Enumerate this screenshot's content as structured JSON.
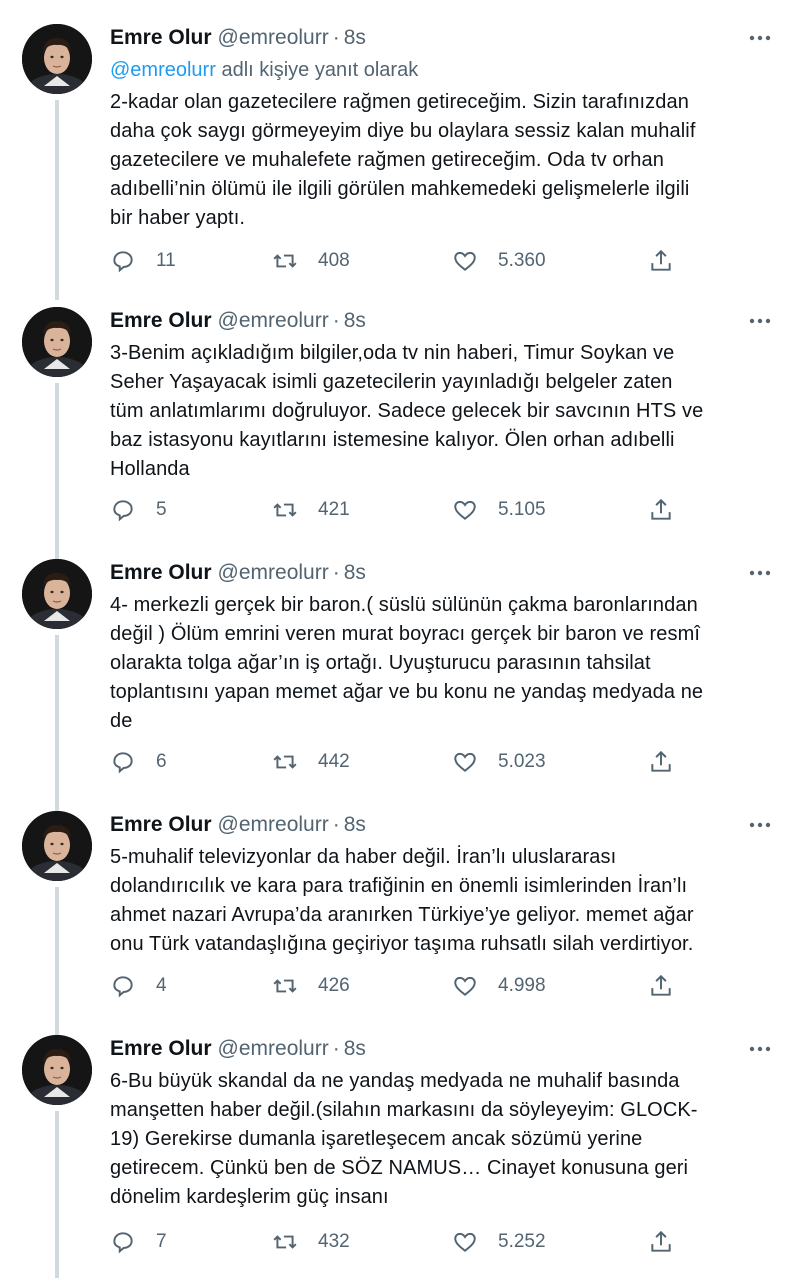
{
  "author": {
    "name": "Emre Olur",
    "handle": "@emreolurr",
    "separator": "·",
    "time": "8s"
  },
  "tweets": [
    {
      "reply_prefix": "adlı kişiye yanıt olarak",
      "reply_mention": "@emreolurr",
      "text": "2-kadar olan gazetecilere rağmen getireceğim. Sizin tarafınızdan\ndaha çok saygı görmeyeyim diye bu olaylara sessiz kalan muhalif\ngazetecilere ve muhalefete rağmen getireceğim. Oda tv orhan\nadıbelli’nin  ölümü ile ilgili görülen mahkemedeki  gelişmelerle ilgili\nbir haber yaptı.",
      "replies": "11",
      "retweets": "408",
      "likes": "5.360"
    },
    {
      "text": "3-Benim açıkladığım bilgiler,oda tv nin haberi, Timur Soykan ve\nSeher Yaşayacak isimli gazetecilerin yayınladığı belgeler zaten\ntüm anlatımlarımı doğruluyor. Sadece gelecek bir savcının HTS ve\nbaz istasyonu kayıtlarını istemesine kalıyor. Ölen orhan adıbelli\nHollanda",
      "replies": "5",
      "retweets": "421",
      "likes": "5.105"
    },
    {
      "text": "4- merkezli gerçek bir baron.( süslü sülünün çakma baronlarından\ndeğil ) Ölüm emrini veren murat boyracı gerçek bir baron ve resmî\nolarakta tolga ağar’ın iş ortağı. Uyuşturucu parasının tahsilat\ntoplantısını yapan memet ağar ve bu konu ne yandaş medyada ne\nde",
      "replies": "6",
      "retweets": "442",
      "likes": "5.023"
    },
    {
      "text": "5-muhalif televizyonlar da haber değil. İran’lı uluslararası\ndolandırıcılık ve kara para trafiğinin en önemli isimlerinden İran’lı\nahmet nazari Avrupa’da aranırken Türkiye’ye geliyor. memet ağar\nonu Türk vatandaşlığına geçiriyor taşıma ruhsatlı silah verdirtiyor.",
      "replies": "4",
      "retweets": "426",
      "likes": "4.998"
    },
    {
      "text": "6-Bu büyük skandal da ne yandaş medyada ne muhalif basında\nmanşetten haber değil.(silahın markasını da söyleyeyim: GLOCK-\n19) Gerekirse dumanla işaretleşecem ancak sözümü yerine\ngetirecem. Çünkü ben de SÖZ NAMUS… Cinayet konusuna geri\ndönelim kardeşlerim güç insanı",
      "replies": "7",
      "retweets": "432",
      "likes": "5.252"
    }
  ],
  "icons": {
    "more": "more-horizontal-icon",
    "reply": "reply-bubble-icon",
    "retweet": "retweet-icon",
    "like": "heart-icon",
    "share": "share-upload-icon"
  },
  "colors": {
    "text": "#0f1419",
    "secondary": "#536471",
    "link": "#1d9bf0",
    "thread_line": "#cfd9de"
  }
}
